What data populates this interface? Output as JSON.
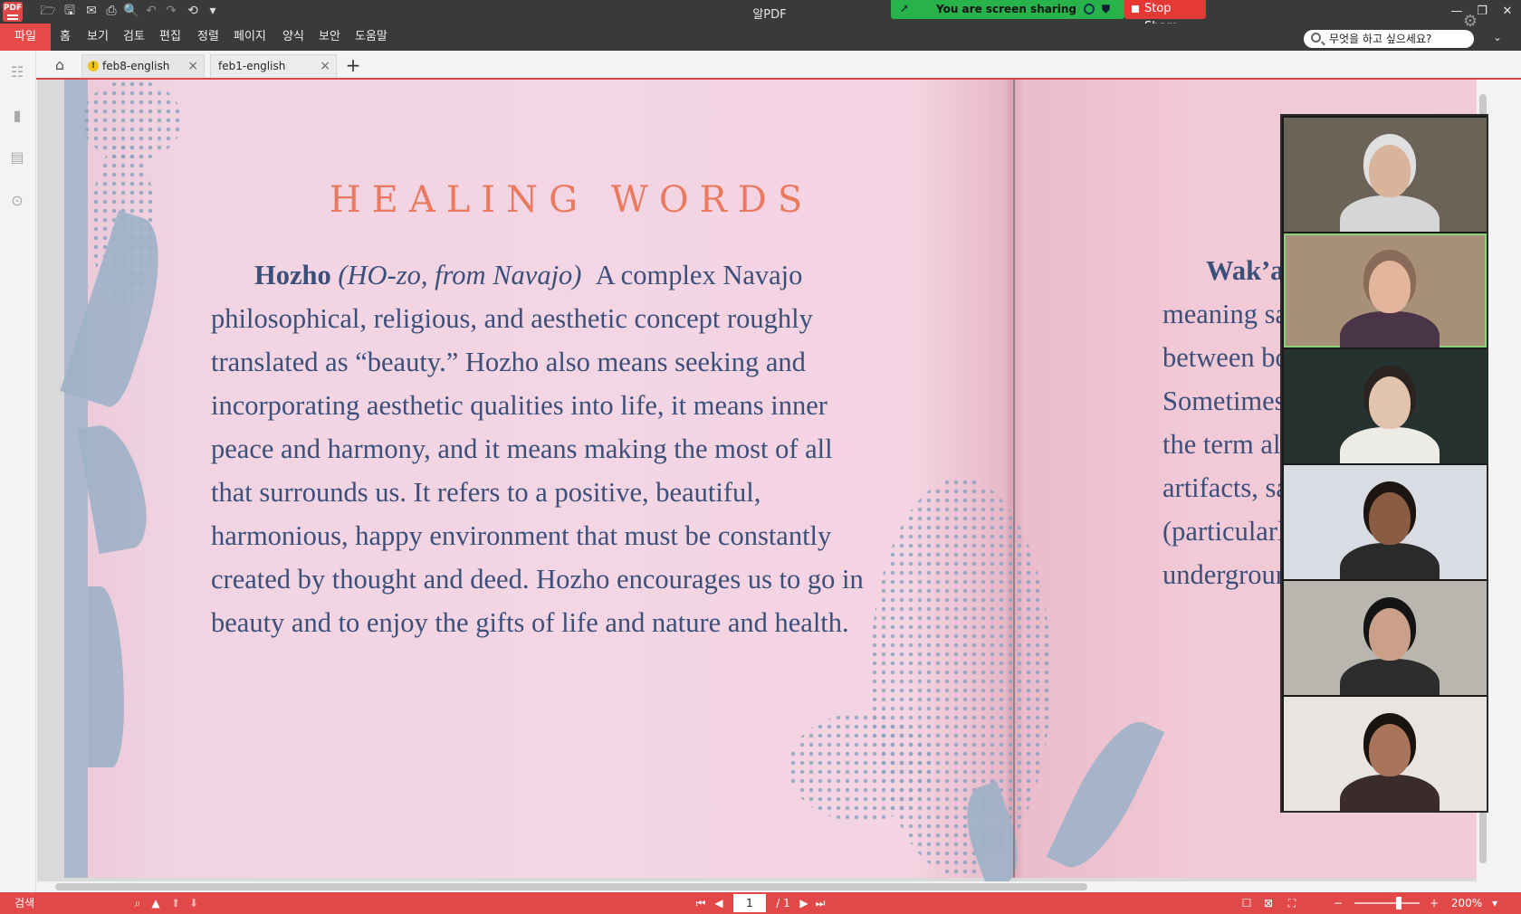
{
  "window": {
    "title": "알PDF",
    "logo_text": "PDF"
  },
  "quick_access": [
    {
      "name": "open-icon",
      "glyph": "🗁"
    },
    {
      "name": "save-icon",
      "glyph": "🖫"
    },
    {
      "name": "mail-icon",
      "glyph": "✉"
    },
    {
      "name": "print-icon",
      "glyph": "⎙"
    },
    {
      "name": "print-preview-icon",
      "glyph": "🔍"
    },
    {
      "name": "undo-icon",
      "glyph": "↶"
    },
    {
      "name": "redo-icon",
      "glyph": "↷"
    },
    {
      "name": "history-icon",
      "glyph": "⟲"
    },
    {
      "name": "customize-icon",
      "glyph": "▾"
    }
  ],
  "screen_share": {
    "status": "You are screen sharing",
    "stop_label": "Stop Share"
  },
  "menu": {
    "items": [
      "파일",
      "홈",
      "보기",
      "검토",
      "편집",
      "정렬",
      "페이지",
      "양식",
      "보안",
      "도움말"
    ],
    "search_placeholder": "무엇을 하고 싶으세요?"
  },
  "tabs": [
    {
      "label": "feb8-english",
      "warning": "!",
      "close": "×"
    },
    {
      "label": "feb1-english",
      "close": "×"
    }
  ],
  "tab_add": "+",
  "document": {
    "heading": "HEALING WORDS",
    "left_lines": [
      {
        "term": "Hozho",
        "pron": "(HO-zo, from Navajo)",
        "text": "A complex Navajo"
      },
      "philosophical, religious, and aesthetic concept roughly",
      "translated as “beauty.” Hozho also means seeking and",
      "incorporating aesthetic qualities into life, it means inner",
      "peace and harmony, and it means making the most of all",
      "that surrounds us. It refers to a positive, beautiful,",
      "harmonious, happy environment that must be constantly",
      "created by thought and deed. Hozho encourages us to go in",
      "beauty and to enjoy the gifts of life and nature and health."
    ],
    "right_lines": [
      {
        "term": "Wak’a",
        "text": "("
      },
      "meaning sac",
      "between boc",
      "Sometimes s",
      "the term also",
      "artifacts, sac",
      "(particularly",
      "undergroun"
    ]
  },
  "status_bar": {
    "search_label": "검색",
    "page_current": "1",
    "page_total": "/ 1",
    "zoom": "200%"
  },
  "participants": [
    {
      "name": "participant-1",
      "bg": "#6b6258",
      "skin": "#d8b49a",
      "hair": "#e0e0e0",
      "shirt": "#d6d6d6"
    },
    {
      "name": "participant-2",
      "bg": "#a88f78",
      "skin": "#e3b59d",
      "hair": "#8a6a58",
      "shirt": "#4a3448",
      "speaking": true
    },
    {
      "name": "participant-3",
      "bg": "#25322f",
      "skin": "#e2c3ad",
      "hair": "#2a2320",
      "shirt": "#ecebe6"
    },
    {
      "name": "participant-4",
      "bg": "#d9dde3",
      "skin": "#8a5c44",
      "hair": "#1c1512",
      "shirt": "#2a2a2a"
    },
    {
      "name": "participant-5",
      "bg": "#b9b6b0",
      "skin": "#caa088",
      "hair": "#141414",
      "shirt": "#2d2d2d"
    },
    {
      "name": "participant-6",
      "bg": "#e8e4df",
      "skin": "#a8745a",
      "hair": "#1a1410",
      "shirt": "#3a2c2c"
    }
  ]
}
